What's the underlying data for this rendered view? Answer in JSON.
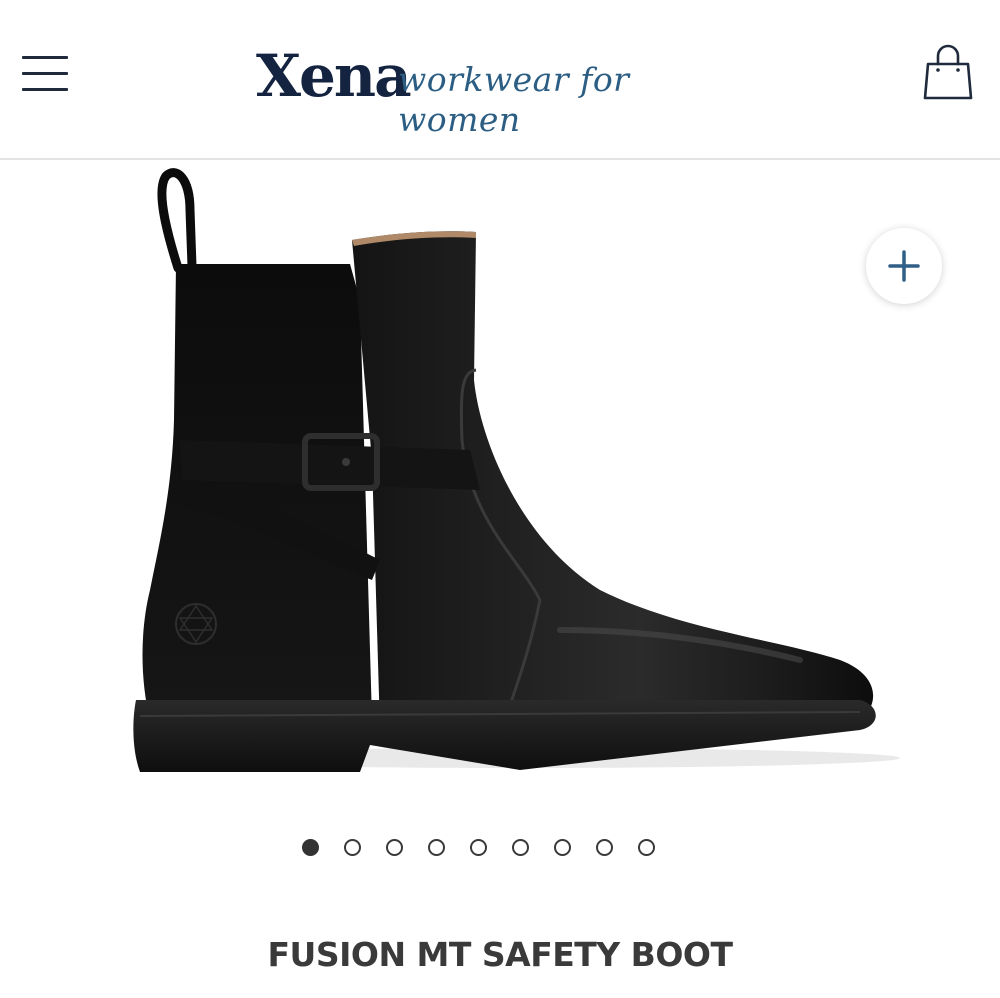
{
  "header": {
    "brand_name": "Xena",
    "brand_tagline": "workwear for women",
    "menu_icon": "hamburger-menu-icon",
    "cart_icon": "shopping-bag-icon"
  },
  "gallery": {
    "image_alt": "Black leather ankle boot with buckle strap",
    "zoom_icon": "plus-icon",
    "slide_count": 9,
    "active_slide": 1
  },
  "product": {
    "title": "FUSION MT SAFETY BOOT"
  },
  "colors": {
    "brand_navy": "#14233f",
    "tagline_blue": "#2c5e84",
    "zoom_plus": "#2f5f86",
    "text_dark": "#3a3a3a"
  }
}
